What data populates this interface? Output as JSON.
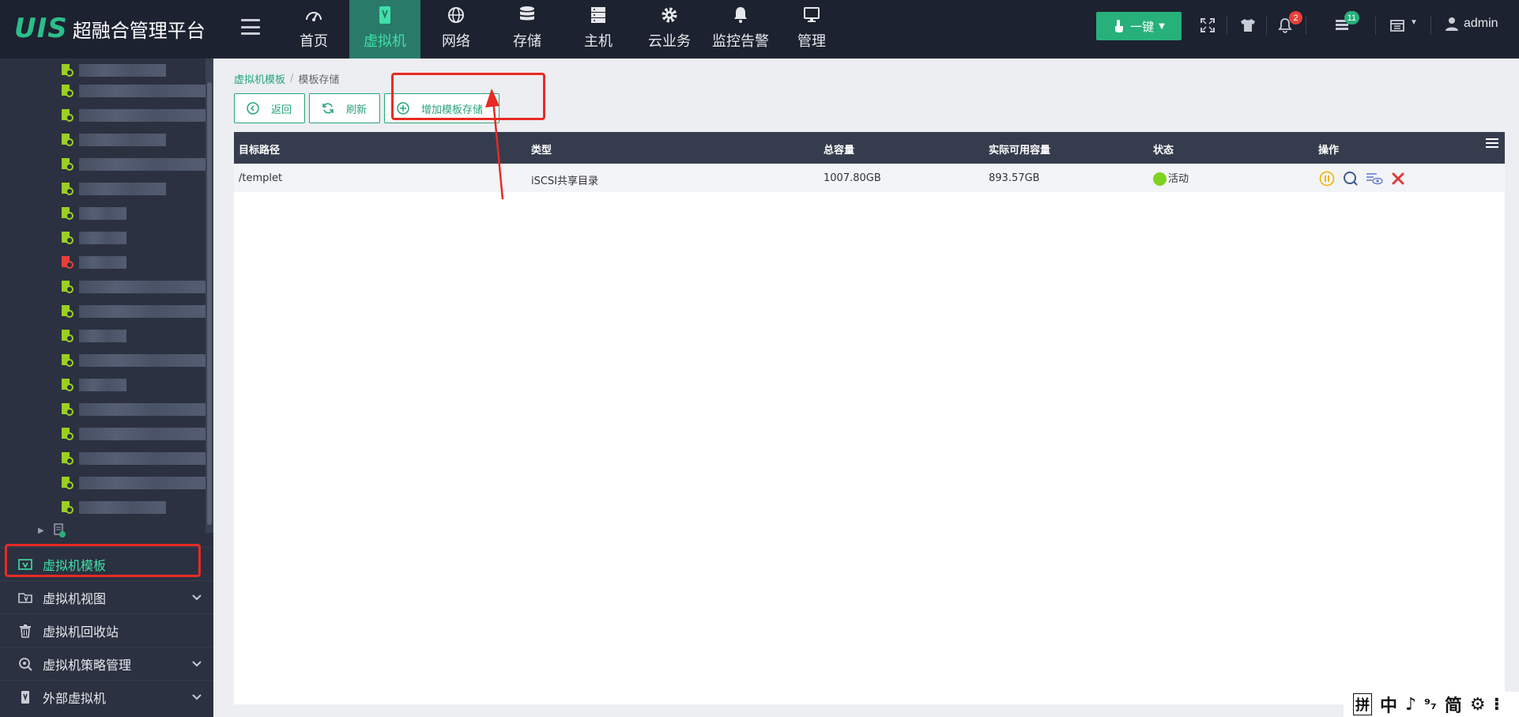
{
  "app": {
    "logo_mark": "UIS",
    "title": "超融合管理平台"
  },
  "nav": [
    {
      "label": "首页",
      "icon": "dashboard-icon",
      "active": false
    },
    {
      "label": "虚拟机",
      "icon": "vm-icon",
      "active": true
    },
    {
      "label": "网络",
      "icon": "globe-icon",
      "active": false
    },
    {
      "label": "存储",
      "icon": "database-icon",
      "active": false
    },
    {
      "label": "主机",
      "icon": "server-icon",
      "active": false
    },
    {
      "label": "云业务",
      "icon": "gear-icon",
      "active": false
    },
    {
      "label": "监控告警",
      "icon": "bell-alert-icon",
      "active": false
    },
    {
      "label": "管理",
      "icon": "monitor-icon",
      "active": false
    }
  ],
  "toolbar": {
    "onekey_label": "一键",
    "alerts_count": "2",
    "tasks_count": "11",
    "user": "admin"
  },
  "sidebar": {
    "menu": [
      {
        "label": "虚拟机模板",
        "icon": "template-icon",
        "active": true,
        "has_chevron": false
      },
      {
        "label": "虚拟机视图",
        "icon": "folder-view-icon",
        "active": false,
        "has_chevron": true
      },
      {
        "label": "虚拟机回收站",
        "icon": "trash-icon",
        "active": false,
        "has_chevron": false
      },
      {
        "label": "虚拟机策略管理",
        "icon": "policy-icon",
        "active": false,
        "has_chevron": true
      },
      {
        "label": "外部虚拟机",
        "icon": "external-vm-icon",
        "active": false,
        "has_chevron": true
      }
    ]
  },
  "breadcrumb": {
    "parent": "虚拟机模板",
    "current": "模板存储"
  },
  "buttons": {
    "back": "返回",
    "refresh": "刷新",
    "add_storage": "增加模板存储"
  },
  "table": {
    "headers": [
      "目标路径",
      "类型",
      "总容量",
      "实际可用容量",
      "状态",
      "操作"
    ],
    "rows": [
      {
        "path": "/templet",
        "type": "iSCSI共享目录",
        "total": "1007.80GB",
        "available": "893.57GB",
        "status": "活动"
      }
    ]
  },
  "ime": [
    "拼",
    "中",
    "♪",
    "⁹₇",
    "简",
    "⚙",
    "⁝"
  ],
  "colors": {
    "accent": "#27a57a",
    "topbar": "#1d2230",
    "sidebar": "#2b3140",
    "highlight": "#e82b25",
    "status_active": "#7ed321"
  }
}
